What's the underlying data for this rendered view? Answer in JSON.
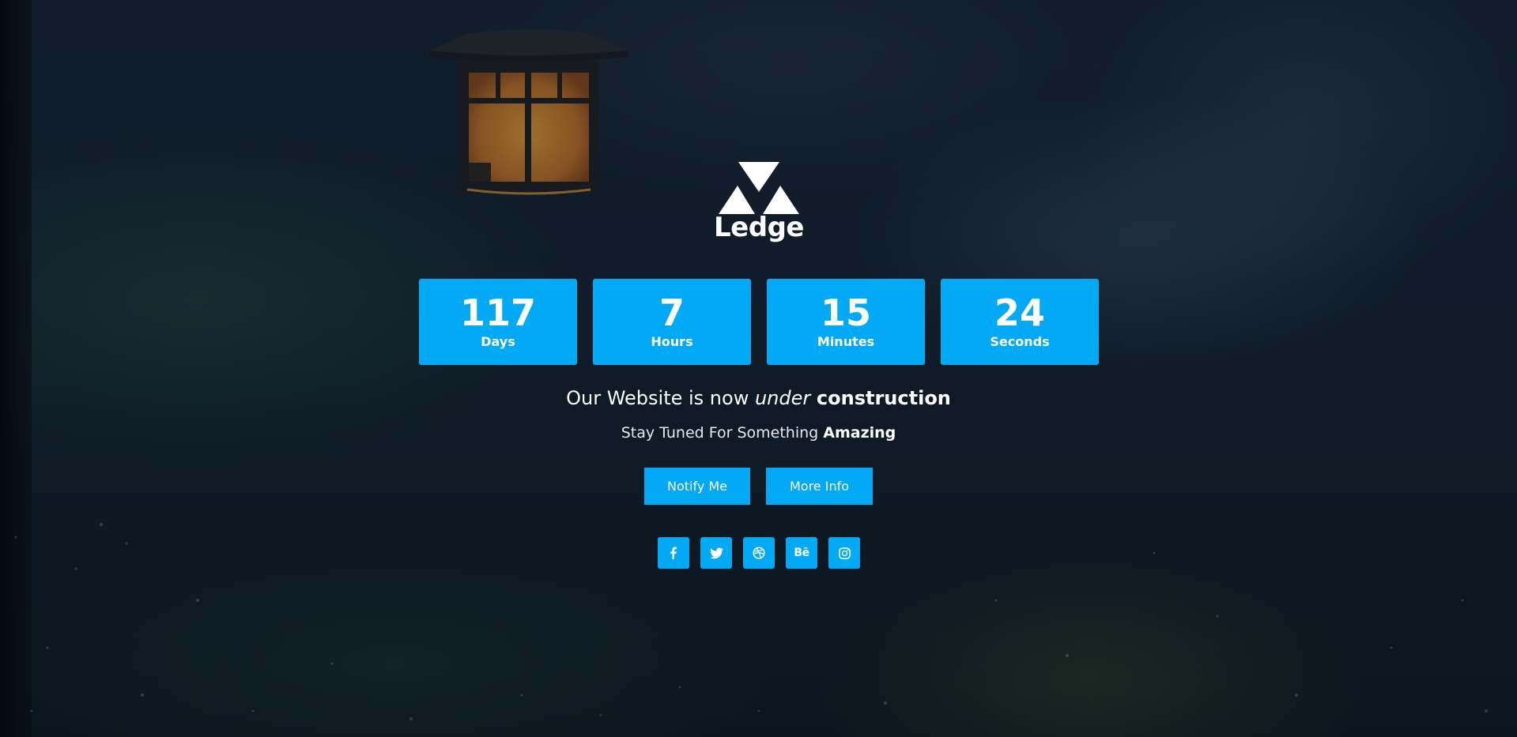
{
  "brand": {
    "name": "Ledge",
    "logo_icon": "triangles-logo-icon"
  },
  "countdown": [
    {
      "value": "117",
      "label": "Days"
    },
    {
      "value": "7",
      "label": "Hours"
    },
    {
      "value": "15",
      "label": "Minutes"
    },
    {
      "value": "24",
      "label": "Seconds"
    }
  ],
  "headline": {
    "part1": "Our Website is now ",
    "emphasis": "under",
    "part2": " ",
    "strong": "construction"
  },
  "subline": {
    "text": "Stay Tuned For Something ",
    "strong": "Amazing"
  },
  "buttons": {
    "notify_label": "Notify Me",
    "more_label": "More Info"
  },
  "social": [
    {
      "name": "facebook",
      "icon": "facebook-icon"
    },
    {
      "name": "twitter",
      "icon": "twitter-icon"
    },
    {
      "name": "dribbble",
      "icon": "dribbble-icon"
    },
    {
      "name": "behance",
      "icon": "behance-icon",
      "glyph": "Bē"
    },
    {
      "name": "instagram",
      "icon": "instagram-icon"
    }
  ],
  "colors": {
    "accent": "#03a9f4",
    "text": "#ffffff"
  }
}
